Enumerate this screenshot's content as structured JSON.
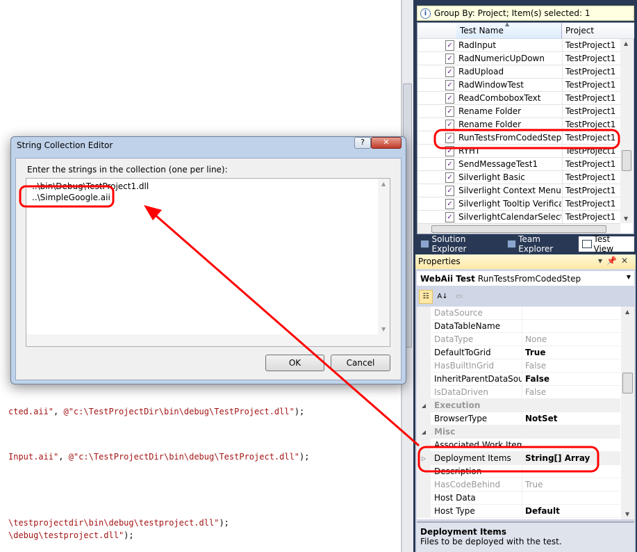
{
  "editor": {
    "code_lines": [
      {
        "s": "cted.aii\"",
        "p": ", ",
        "s2": "@\"c:\\TestProjectDir\\bin\\debug\\TestProject.dll\"",
        "e": ");"
      },
      {
        "s": "Input.aii\"",
        "p": ", ",
        "s2": "@\"c:\\TestProjectDir\\bin\\debug\\TestProject.dll\"",
        "e": ");"
      },
      {
        "s": "\\testprojectdir\\bin\\debug\\testproject.dll\"",
        "p": "",
        "s2": "",
        "e": ");"
      },
      {
        "s": "\\debug\\testproject.dll\"",
        "p": "",
        "s2": "",
        "e": ");"
      }
    ]
  },
  "test_view": {
    "info": "Group By: Project; Item(s) selected: 1",
    "columns": [
      "Test Name",
      "Project"
    ],
    "rows": [
      {
        "name": "RadInput",
        "project": "TestProject1"
      },
      {
        "name": "RadNumericUpDown",
        "project": "TestProject1"
      },
      {
        "name": "RadUpload",
        "project": "TestProject1"
      },
      {
        "name": "RadWindowTest",
        "project": "TestProject1"
      },
      {
        "name": "ReadComboboxText",
        "project": "TestProject1"
      },
      {
        "name": "Rename Folder",
        "project": "TestProject1"
      },
      {
        "name": "Rename Folder",
        "project": "TestProject1"
      },
      {
        "name": "RunTestsFromCodedStep",
        "project": "TestProject1",
        "selected": true
      },
      {
        "name": "RYHT",
        "project": "TestProject1"
      },
      {
        "name": "SendMessageTest1",
        "project": "TestProject1"
      },
      {
        "name": "Silverlight Basic",
        "project": "TestProject1"
      },
      {
        "name": "Silverlight Context Menu",
        "project": "TestProject1"
      },
      {
        "name": "Silverlight Tooltip Verification",
        "project": "TestProject1"
      },
      {
        "name": "SilverlightCalendarSelection",
        "project": "TestProject1"
      }
    ]
  },
  "tabs": [
    {
      "label": "Solution Explorer"
    },
    {
      "label": "Team Explorer"
    },
    {
      "label": "Test View",
      "active": true
    }
  ],
  "properties": {
    "title": "Properties",
    "object_type": "WebAii Test",
    "object_name": "RunTestsFromCodedStep",
    "rows": [
      {
        "k": "DataSource",
        "v": "",
        "style": "dis"
      },
      {
        "k": "DataTableName",
        "v": "",
        "style": ""
      },
      {
        "k": "DataType",
        "v": "None",
        "style": "dis"
      },
      {
        "k": "DefaultToGrid",
        "v": "True",
        "style": "bold"
      },
      {
        "k": "HasBuiltInGrid",
        "v": "False",
        "style": "dis"
      },
      {
        "k": "InheritParentDataSource",
        "v": "False",
        "style": "bold"
      },
      {
        "k": "IsDataDriven",
        "v": "False",
        "style": "dis"
      },
      {
        "k": "Execution",
        "v": "",
        "style": "cat"
      },
      {
        "k": "BrowserType",
        "v": "NotSet",
        "style": "bold"
      },
      {
        "k": "Misc",
        "v": "",
        "style": "cat"
      },
      {
        "k": "Associated Work Items",
        "v": "",
        "style": ""
      },
      {
        "k": "Deployment Items",
        "v": "String[] Array",
        "style": "bold sel"
      },
      {
        "k": "Description",
        "v": "",
        "style": ""
      },
      {
        "k": "HasCodeBehind",
        "v": "True",
        "style": "dis"
      },
      {
        "k": "Host Data",
        "v": "",
        "style": ""
      },
      {
        "k": "Host Type",
        "v": "Default",
        "style": "bold"
      }
    ],
    "desc_title": "Deployment Items",
    "desc_text": "Files to be deployed with the test."
  },
  "dialog": {
    "title": "String Collection Editor",
    "help": "?",
    "close": "✕",
    "label": "Enter the strings in the collection (one per line):",
    "lines": [
      "..\\bin\\Debug\\TestProject1.dll",
      "..\\SimpleGoogle.aii"
    ],
    "ok": "OK",
    "cancel": "Cancel"
  },
  "colors": {
    "annotation": "#ff0000",
    "panel_bg": "#293955",
    "string": "#a31515"
  }
}
